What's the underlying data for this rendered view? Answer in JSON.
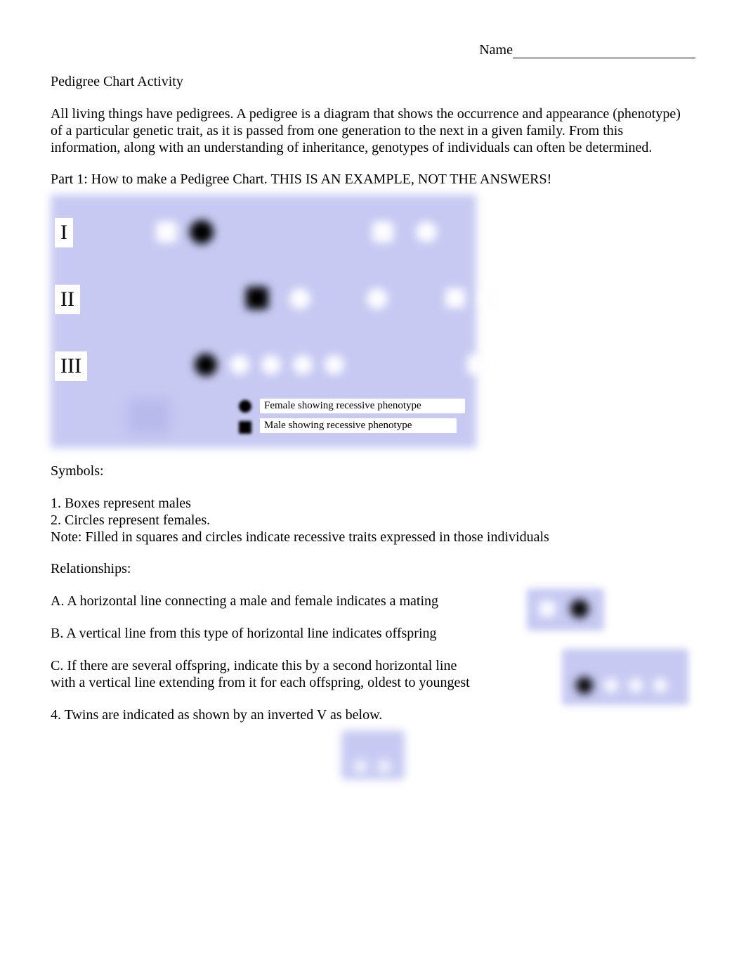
{
  "header": {
    "name_label": "Name"
  },
  "title": "Pedigree Chart Activity",
  "intro": "All living things have pedigrees. A pedigree is a diagram that shows the occurrence and appearance (phenotype) of a particular genetic trait, as it is passed from one generation to the next in a given family. From this information, along with an understanding of inheritance, genotypes of individuals can often be determined.",
  "part1_heading": "Part 1: How to make a Pedigree Chart. THIS IS AN EXAMPLE, NOT THE ANSWERS!",
  "chart_data": {
    "type": "pedigree",
    "generations": [
      {
        "label": "I",
        "members": [
          {
            "sex": "male",
            "affected": false,
            "mate_right": true
          },
          {
            "sex": "female",
            "affected": true
          },
          {
            "sex": "male",
            "affected": false,
            "mate_right": true
          },
          {
            "sex": "female",
            "affected": false
          }
        ]
      },
      {
        "label": "II",
        "members": [
          {
            "sex": "male",
            "affected": true,
            "mate_right": true
          },
          {
            "sex": "female",
            "affected": false
          },
          {
            "sex": "female",
            "affected": false
          },
          {
            "sex": "male",
            "affected": false,
            "mate_right": true
          },
          {
            "sex": "female",
            "affected": false
          }
        ]
      },
      {
        "label": "III",
        "members": [
          {
            "sex": "female",
            "affected": true
          },
          {
            "sex": "female",
            "affected": false
          },
          {
            "sex": "female",
            "affected": false
          },
          {
            "sex": "female",
            "affected": false
          },
          {
            "sex": "female",
            "affected": false
          },
          {
            "sex": "male",
            "affected": false
          }
        ]
      }
    ],
    "legend": {
      "female_affected": "Female showing recessive phenotype",
      "male_affected": "Male showing recessive phenotype"
    }
  },
  "symbols_heading": "Symbols:",
  "symbols": {
    "item1": "1. Boxes represent males",
    "item2": "2. Circles represent females.",
    "note": "Note: Filled in squares and circles indicate recessive traits expressed in those individuals"
  },
  "relationships_heading": "Relationships:",
  "relationships": {
    "a": "A.  A horizontal line connecting a male and female indicates a mating",
    "b": "B. A vertical line from this type of horizontal line indicates offspring",
    "c": "C. If there are several offspring, indicate this by a second horizontal line with a vertical line extending from it for each offspring, oldest to youngest",
    "d": "4. Twins are indicated as shown by an inverted V as below."
  }
}
